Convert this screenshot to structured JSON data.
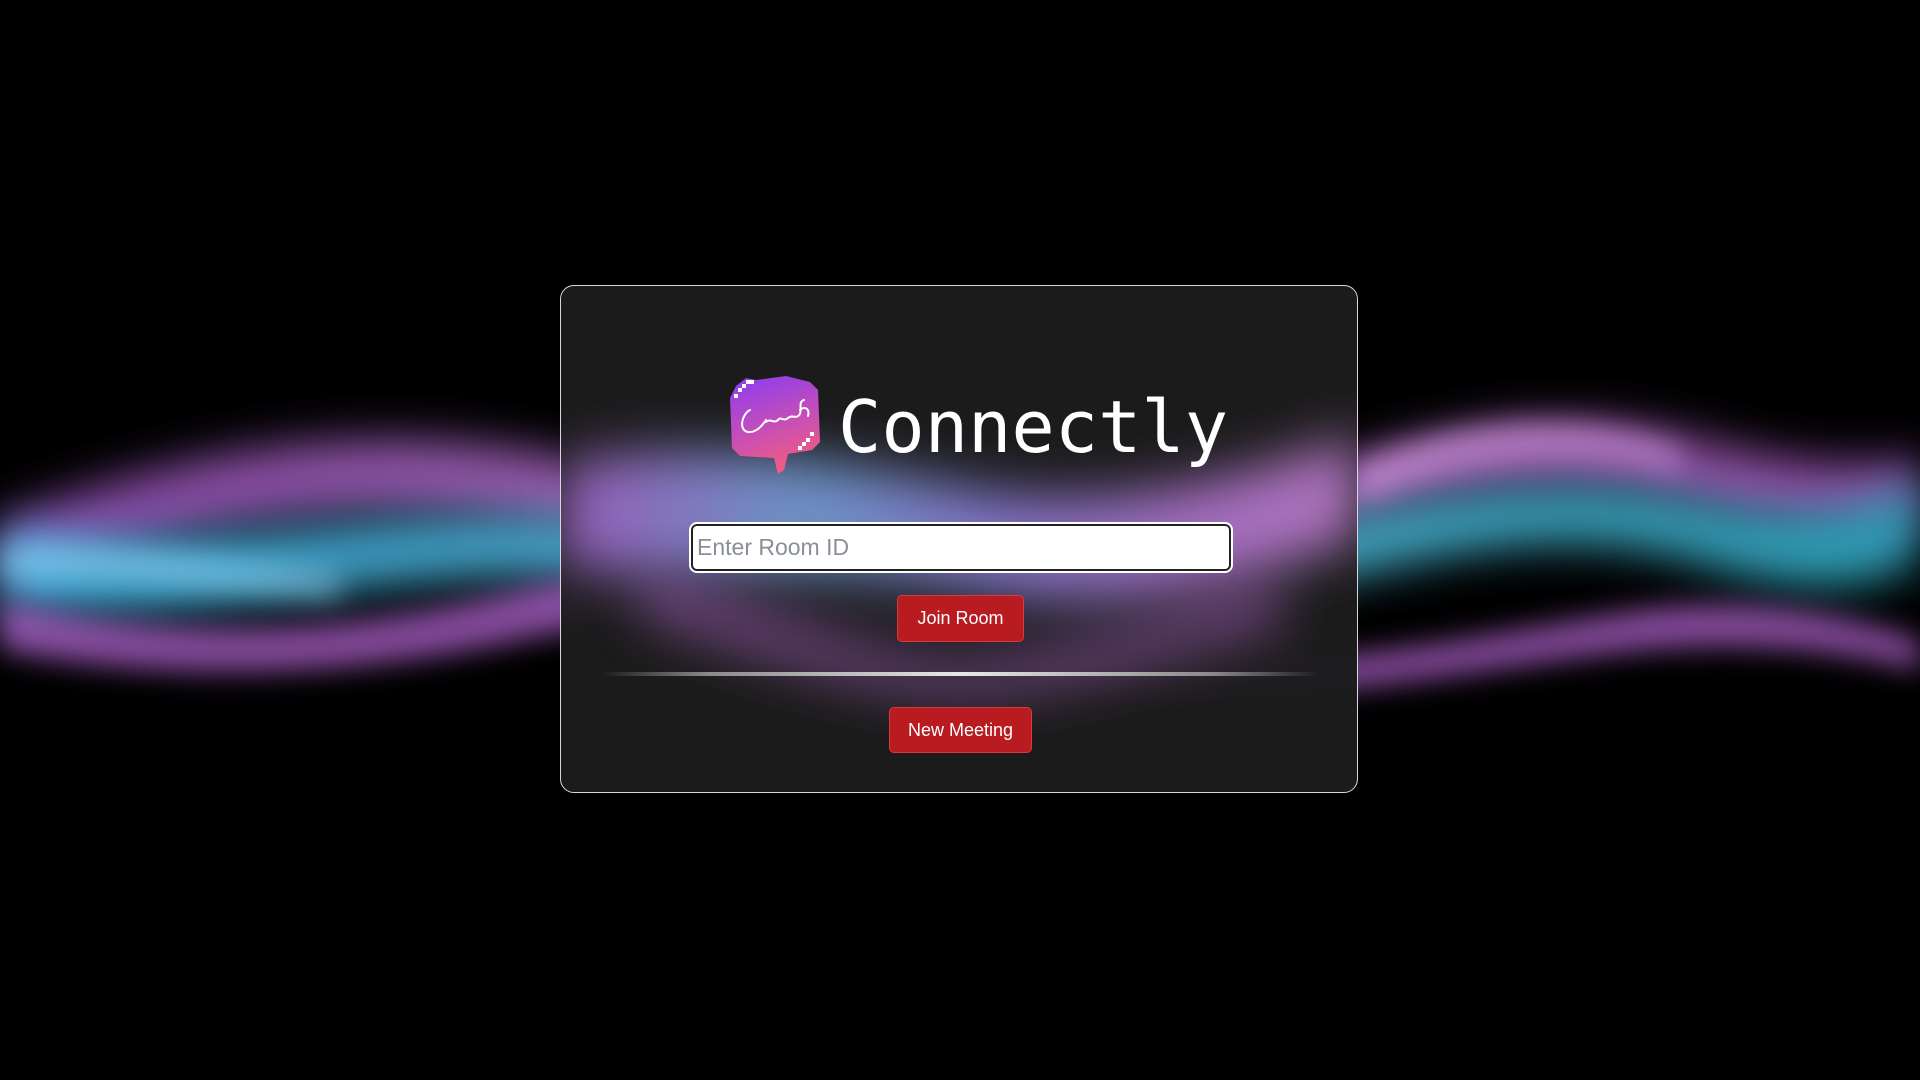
{
  "app": {
    "name": "Connectly",
    "logo_text": "Connectly"
  },
  "join": {
    "input_placeholder": "Enter Room ID",
    "input_value": "",
    "join_button_label": "Join Room"
  },
  "meeting": {
    "new_button_label": "New Meeting"
  },
  "colors": {
    "background": "#000000",
    "card": "#1c1c1c",
    "button": "#b81c21",
    "wave_cyan": "#3fb6e8",
    "wave_pink": "#c77ae0",
    "logo_top": "#8a3cf0",
    "logo_bottom": "#ef5a86"
  },
  "icons": {
    "logo": "chat-bubble-logo-icon"
  }
}
